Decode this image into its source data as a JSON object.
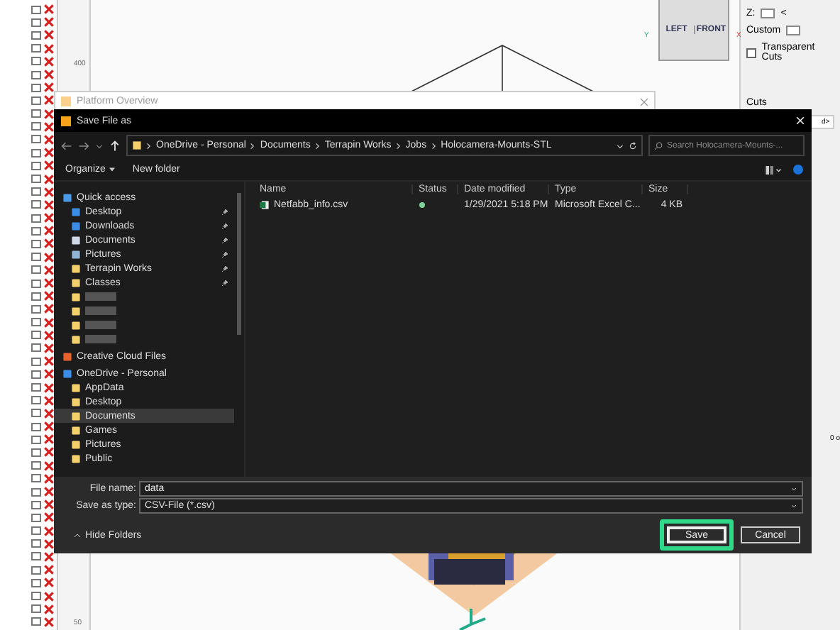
{
  "app": {
    "part_rows": [
      {
        "checked": false
      },
      {
        "checked": false
      },
      {
        "checked": false
      },
      {
        "checked": false
      },
      {
        "checked": false
      },
      {
        "checked": false
      },
      {
        "checked": false
      },
      {
        "checked": false
      },
      {
        "checked": false
      },
      {
        "checked": false
      },
      {
        "checked": false
      },
      {
        "checked": false
      },
      {
        "checked": false
      },
      {
        "checked": false
      },
      {
        "checked": false
      },
      {
        "checked": false
      },
      {
        "checked": false
      },
      {
        "checked": false
      },
      {
        "checked": false
      },
      {
        "checked": false
      },
      {
        "checked": false
      },
      {
        "checked": false
      },
      {
        "checked": false
      },
      {
        "checked": false
      },
      {
        "checked": false
      },
      {
        "checked": false
      },
      {
        "checked": false
      },
      {
        "checked": false
      },
      {
        "checked": false
      },
      {
        "checked": false
      },
      {
        "checked": false
      },
      {
        "checked": false
      },
      {
        "checked": false
      },
      {
        "checked": false
      },
      {
        "checked": false
      },
      {
        "checked": false
      },
      {
        "checked": false
      },
      {
        "checked": false
      },
      {
        "checked": false
      },
      {
        "checked": false
      },
      {
        "checked": false
      },
      {
        "checked": false
      },
      {
        "checked": false
      },
      {
        "checked": false
      },
      {
        "checked": false
      },
      {
        "checked": false
      },
      {
        "checked": false
      },
      {
        "checked": false
      }
    ],
    "ruler_labels": [
      "400",
      "50"
    ],
    "view_cube": {
      "left": "LEFT",
      "front": "FRONT",
      "axis_y": "Y",
      "axis_x": "X"
    },
    "right_panel": {
      "z_label": "Z:",
      "z_sign": "<",
      "custom_label": "Custom",
      "transparent_cuts": {
        "label": "Transparent Cuts",
        "checked": false
      },
      "cuts_label": "Cuts",
      "cuts_value": "d>",
      "side_text": "0 o"
    },
    "background_window": {
      "title": "Platform Overview"
    }
  },
  "dialog": {
    "title": "Save File as",
    "breadcrumbs": [
      "OneDrive - Personal",
      "Documents",
      "Terrapin Works",
      "Jobs",
      "Holocamera-Mounts-STL"
    ],
    "search": {
      "placeholder": "Search Holocamera-Mounts-..."
    },
    "toolbar": {
      "organize": "Organize",
      "new_folder": "New folder"
    },
    "nav": [
      {
        "kind": "group",
        "label": "Quick access",
        "pinned": false,
        "selected": false
      },
      {
        "kind": "item",
        "label": "Desktop",
        "pinned": true,
        "selected": false
      },
      {
        "kind": "item",
        "label": "Downloads",
        "pinned": true,
        "selected": false
      },
      {
        "kind": "item",
        "label": "Documents",
        "pinned": true,
        "selected": false
      },
      {
        "kind": "item",
        "label": "Pictures",
        "pinned": true,
        "selected": false
      },
      {
        "kind": "item",
        "label": "Terrapin Works",
        "pinned": true,
        "selected": false
      },
      {
        "kind": "item",
        "label": "Classes",
        "pinned": true,
        "selected": false
      },
      {
        "kind": "hidden",
        "pinned": false,
        "selected": false
      },
      {
        "kind": "hidden",
        "pinned": false,
        "selected": false
      },
      {
        "kind": "hidden",
        "pinned": false,
        "selected": false
      },
      {
        "kind": "hidden",
        "pinned": false,
        "selected": false
      },
      {
        "kind": "group",
        "label": "Creative Cloud Files",
        "pinned": false,
        "selected": false
      },
      {
        "kind": "group",
        "label": "OneDrive - Personal",
        "pinned": false,
        "selected": false
      },
      {
        "kind": "item",
        "label": "AppData",
        "pinned": false,
        "selected": false
      },
      {
        "kind": "item",
        "label": "Desktop",
        "pinned": false,
        "selected": false
      },
      {
        "kind": "item",
        "label": "Documents",
        "pinned": false,
        "selected": true
      },
      {
        "kind": "item",
        "label": "Games",
        "pinned": false,
        "selected": false
      },
      {
        "kind": "item",
        "label": "Pictures",
        "pinned": false,
        "selected": false
      },
      {
        "kind": "item",
        "label": "Public",
        "pinned": false,
        "selected": false
      }
    ],
    "columns": [
      "Name",
      "Status",
      "Date modified",
      "Type",
      "Size"
    ],
    "files": [
      {
        "name": "Netfabb_info.csv",
        "synced": true,
        "date": "1/29/2021 5:18 PM",
        "type": "Microsoft Excel C...",
        "size": "4 KB"
      }
    ],
    "file_name": {
      "label": "File name:",
      "value": "data"
    },
    "save_type": {
      "label": "Save as type:",
      "value": "CSV-File (*.csv)"
    },
    "hide_folders": "Hide Folders",
    "buttons": [
      {
        "label": "Save",
        "highlighted": true
      },
      {
        "label": "Cancel",
        "highlighted": false
      }
    ]
  }
}
